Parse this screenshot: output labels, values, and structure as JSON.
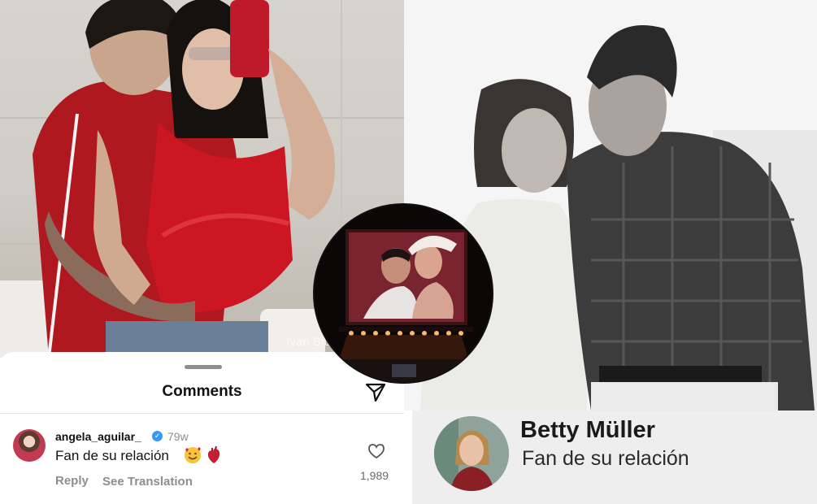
{
  "left_photo": {
    "watermark": "Ivan Biu"
  },
  "comments_panel": {
    "title": "Comments",
    "share_icon": "paper-plane-icon",
    "comment": {
      "username": "angela_aguilar_",
      "verified": true,
      "time": "79w",
      "text": "Fan de su relación",
      "emojis": [
        "smiling-face-with-hearts",
        "anatomical-heart"
      ],
      "reply_label": "Reply",
      "translate_label": "See Translation",
      "like_icon": "heart-outline-icon",
      "like_count": "1,989"
    }
  },
  "name_card": {
    "name": "Betty Müller",
    "text": "Fan de su relación"
  },
  "colors": {
    "verified_blue": "#3897f0",
    "muted_text": "#8e8e8e",
    "dress_red": "#c8141f",
    "card_bg": "#efeeee"
  }
}
